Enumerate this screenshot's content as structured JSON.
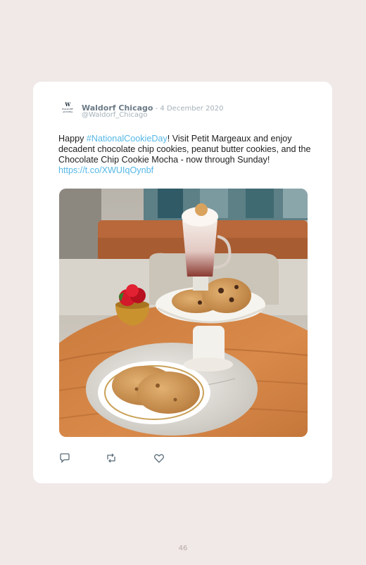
{
  "tweet": {
    "author_name": "Waldorf Chicago",
    "date": " - 4 December 2020",
    "handle": "@Waldorf_Chicago",
    "avatar_monogram": "W",
    "avatar_wordmark_1": "WALDORF",
    "avatar_wordmark_2": "ASTORIA",
    "text_before_hashtag": "Happy ",
    "hashtag": "#NationalCookieDay",
    "text_after_hashtag": "! Visit Petit Margeaux and enjoy decadent chocolate chip cookies, peanut butter cookies, and the Chocolate Chip Cookie Mocha - now through Sunday! ",
    "link": "https://t.co/XWUIqOynbf"
  },
  "actions": {
    "reply_icon": "reply-icon",
    "retweet_icon": "retweet-icon",
    "like_icon": "heart-icon"
  },
  "colors": {
    "background": "#f0e9e7",
    "card": "#ffffff",
    "link": "#55b8e6",
    "name": "#6b7a86",
    "meta": "#a6b1b9"
  },
  "page": {
    "number": "46"
  }
}
